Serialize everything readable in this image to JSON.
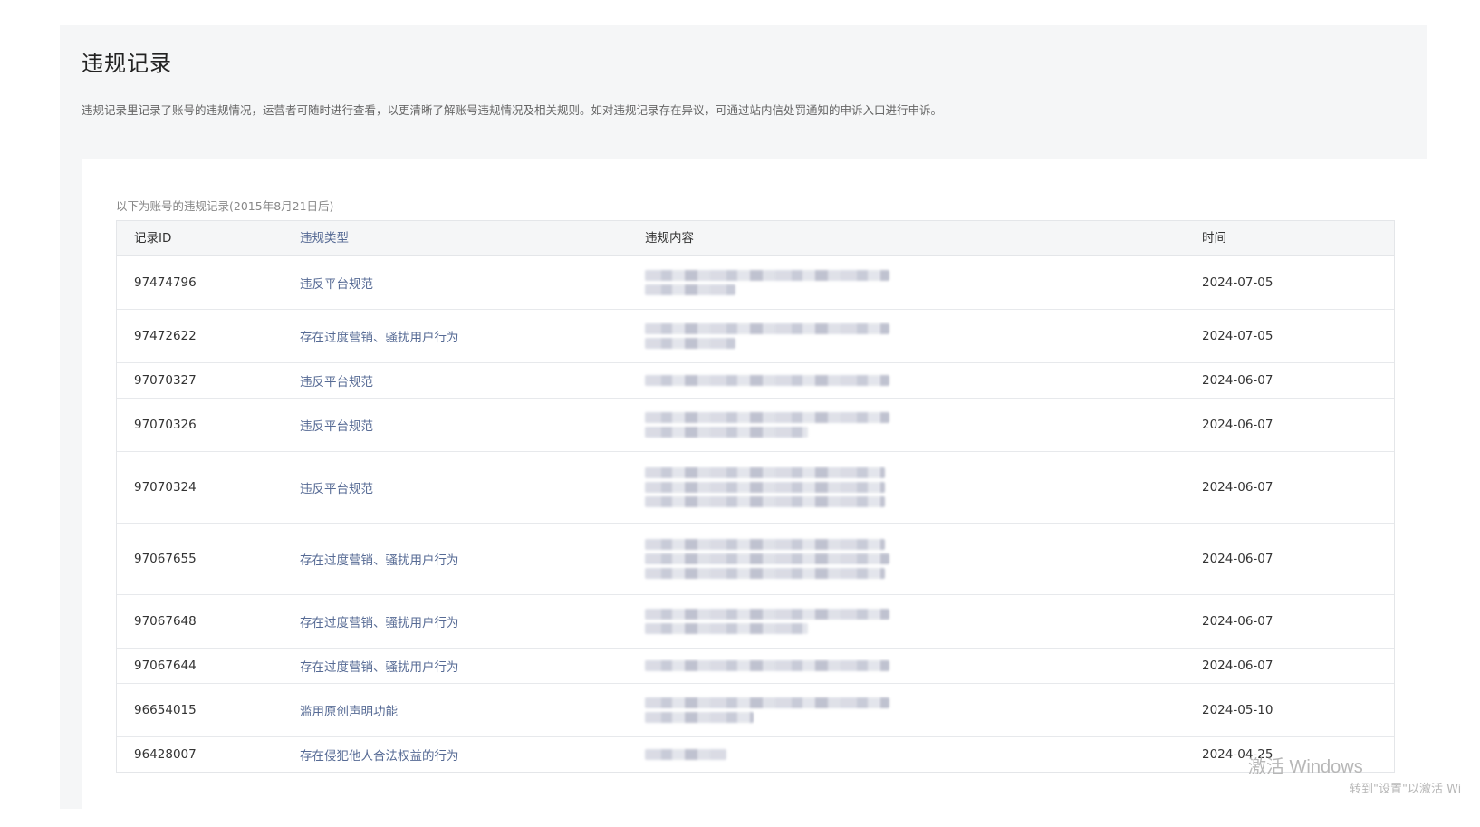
{
  "page": {
    "title": "违规记录",
    "description": "违规记录里记录了账号的违规情况，运营者可随时进行查看，以更清晰了解账号违规情况及相关规则。如对违规记录存在异议，可通过站内信处罚通知的申诉入口进行申诉。",
    "caption": "以下为账号的违规记录(2015年8月21日后)"
  },
  "table": {
    "headers": {
      "id": "记录ID",
      "type": "违规类型",
      "content": "违规内容",
      "time": "时间"
    },
    "rows": [
      {
        "id": "97474796",
        "type": "违反平台规范",
        "time": "2024-07-05",
        "content_lines": 2
      },
      {
        "id": "97472622",
        "type": "存在过度营销、骚扰用户行为",
        "time": "2024-07-05",
        "content_lines": 2
      },
      {
        "id": "97070327",
        "type": "违反平台规范",
        "time": "2024-06-07",
        "content_lines": 1
      },
      {
        "id": "97070326",
        "type": "违反平台规范",
        "time": "2024-06-07",
        "content_lines": 2
      },
      {
        "id": "97070324",
        "type": "违反平台规范",
        "time": "2024-06-07",
        "content_lines": 3
      },
      {
        "id": "97067655",
        "type": "存在过度营销、骚扰用户行为",
        "time": "2024-06-07",
        "content_lines": 3
      },
      {
        "id": "97067648",
        "type": "存在过度营销、骚扰用户行为",
        "time": "2024-06-07",
        "content_lines": 2
      },
      {
        "id": "97067644",
        "type": "存在过度营销、骚扰用户行为",
        "time": "2024-06-07",
        "content_lines": 1
      },
      {
        "id": "96654015",
        "type": "滥用原创声明功能",
        "time": "2024-05-10",
        "content_lines": 2
      },
      {
        "id": "96428007",
        "type": "存在侵犯他人合法权益的行为",
        "time": "2024-04-25",
        "content_lines": 1
      }
    ]
  },
  "watermark": {
    "line1": "激活 Windows",
    "line2": "转到\"设置\"以激活 Wi"
  }
}
